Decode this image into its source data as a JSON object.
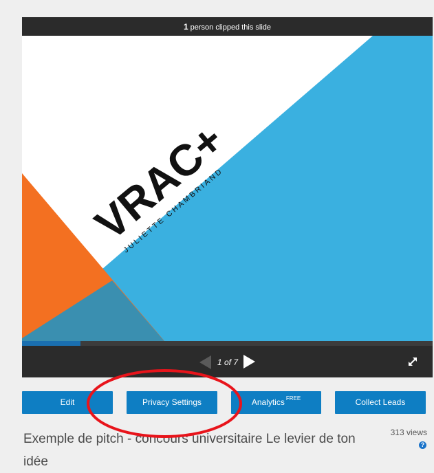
{
  "clip_bar": {
    "count": "1",
    "text": "person clipped this slide"
  },
  "slide": {
    "brand": "VRAC+",
    "author": "JULIETTE CHAMBRIAND",
    "colors": {
      "blue": "#3ab0e0",
      "orange": "#f37021",
      "overlap": "#3a8fb0",
      "white": "#ffffff"
    }
  },
  "player": {
    "progress_fraction": 0.143,
    "page_counter": "1 of 7"
  },
  "actions": {
    "edit": "Edit",
    "privacy": "Privacy Settings",
    "analytics": "Analytics",
    "analytics_badge": "FREE",
    "collect_leads": "Collect Leads"
  },
  "presentation": {
    "title": "Exemple de pitch - concours universitaire Le levier de ton idée",
    "views": "313 views"
  },
  "annotation_color": "#e8141b"
}
